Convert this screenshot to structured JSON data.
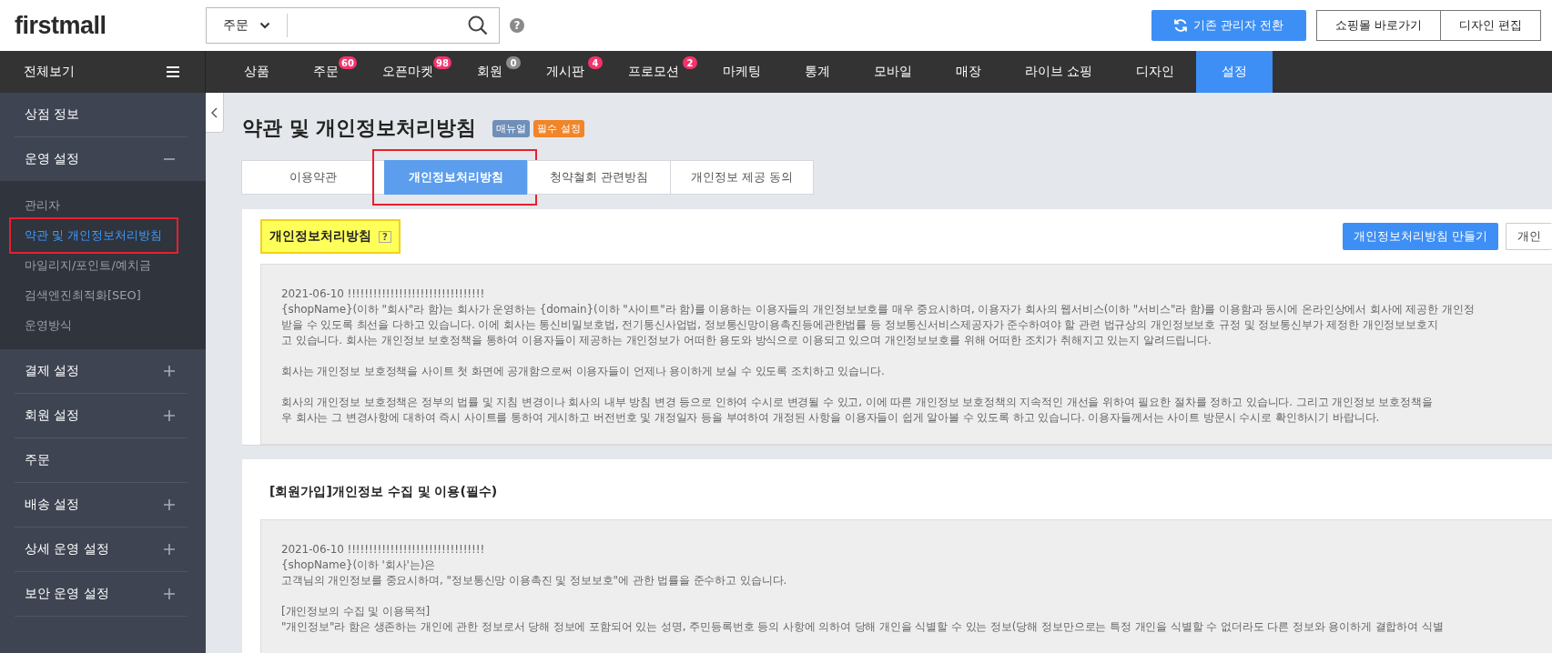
{
  "header": {
    "logo": "firstmall",
    "search": {
      "scope": "주문"
    },
    "help": "?",
    "buttons": [
      {
        "label": "기존 관리자 전환",
        "kind": "primary"
      },
      {
        "label": "쇼핑몰 바로가기",
        "kind": "default"
      },
      {
        "label": "디자인 편집",
        "kind": "default"
      }
    ]
  },
  "menu_header": {
    "label": "전체보기"
  },
  "nav": [
    {
      "label": "상품",
      "selected": false
    },
    {
      "label": "주문",
      "selected": false,
      "badge": {
        "text": "60",
        "color": "#f5336b"
      }
    },
    {
      "label": "오픈마켓",
      "selected": false,
      "badge": {
        "text": "98",
        "color": "#f5336b"
      }
    },
    {
      "label": "회원",
      "selected": false,
      "badge": {
        "text": "0",
        "color": "#8c8c8c"
      }
    },
    {
      "label": "게시판",
      "selected": false,
      "badge": {
        "text": "4",
        "color": "#f5336b"
      }
    },
    {
      "label": "프로모션",
      "selected": false,
      "badge": {
        "text": "2",
        "color": "#f5336b"
      }
    },
    {
      "label": "마케팅",
      "selected": false
    },
    {
      "label": "통계",
      "selected": false
    },
    {
      "label": "모바일",
      "selected": false
    },
    {
      "label": "매장",
      "selected": false
    },
    {
      "label": "라이브 쇼핑",
      "selected": false
    },
    {
      "label": "디자인",
      "selected": false
    },
    {
      "label": "설정",
      "selected": true
    }
  ],
  "sidebar": {
    "items": [
      {
        "label": "상점 정보"
      },
      {
        "label": "운영 설정",
        "expanded": true,
        "children": [
          {
            "label": "관리자",
            "selected": false,
            "highlighted": false
          },
          {
            "label": "약관 및 개인정보처리방침",
            "selected": true,
            "highlighted": true
          },
          {
            "label": "마일리지/포인트/예치금",
            "selected": false,
            "highlighted": false
          },
          {
            "label": "검색엔진최적화[SEO]",
            "selected": false,
            "highlighted": false
          },
          {
            "label": "운영방식",
            "selected": false,
            "highlighted": false
          }
        ]
      },
      {
        "label": "결제 설정",
        "expanded": false
      },
      {
        "label": "회원 설정",
        "expanded": false
      },
      {
        "label": "주문"
      },
      {
        "label": "배송 설정",
        "expanded": false
      },
      {
        "label": "상세 운영 설정",
        "expanded": false
      },
      {
        "label": "보안 운영 설정",
        "expanded": false
      }
    ]
  },
  "page": {
    "title": "약관 및 개인정보처리방침",
    "badges": [
      {
        "text": "매뉴얼",
        "color": "#6f8fb8"
      },
      {
        "text": "필수 설정",
        "color": "#f0852a"
      }
    ]
  },
  "tabs": [
    {
      "label": "이용약관",
      "selected": false,
      "highlighted": false
    },
    {
      "label": "개인정보처리방침",
      "selected": true,
      "highlighted": true
    },
    {
      "label": "청약철회 관련방침",
      "selected": false,
      "highlighted": false
    },
    {
      "label": "개인정보 제공 동의",
      "selected": false,
      "highlighted": false
    }
  ],
  "sections": [
    {
      "title": "개인정보처리방침",
      "help": "?",
      "highlighted": true,
      "buttons": [
        {
          "label": "개인정보처리방침 만들기",
          "kind": "primary"
        },
        {
          "label": "개인",
          "kind": "default"
        }
      ],
      "paragraphs": [
        [
          "2021-06-10 !!!!!!!!!!!!!!!!!!!!!!!!!!!!!!!!",
          "{shopName}(이하 \"회사\"라 함)는 회사가 운영하는 {domain}(이하 \"사이트\"라 함)를 이용하는 이용자들의 개인정보보호를 매우 중요시하며, 이용자가 회사의 웹서비스(이하 \"서비스\"라 함)를 이용함과 동시에 온라인상에서 회사에 제공한 개인정",
          "받을 수 있도록 최선을 다하고 있습니다. 이에 회사는 통신비밀보호법, 전기통신사업법, 정보통신망이용촉진등에관한법률 등 정보통신서비스제공자가 준수하여야 할 관련 법규상의 개인정보보호 규정 및 정보통신부가 제정한 개인정보보호지",
          "고 있습니다. 회사는 개인정보 보호정책을 통하여 이용자들이 제공하는 개인정보가 어떠한 용도와 방식으로 이용되고 있으며 개인정보보호를 위해 어떠한 조치가 취해지고 있는지 알려드립니다."
        ],
        [
          "회사는 개인정보 보호정책을 사이트 첫 화면에 공개함으로써 이용자들이 언제나 용이하게 보실 수 있도록 조치하고 있습니다."
        ],
        [
          "회사의 개인정보 보호정책은 정부의 법률 및 지침 변경이나 회사의 내부 방침 변경 등으로 인하여 수시로 변경될 수 있고, 이에 따른 개인정보 보호정책의 지속적인 개선을 위하여 필요한 절차를 정하고 있습니다. 그리고 개인정보 보호정책을",
          "우 회사는 그 변경사항에 대하여 즉시 사이트를 통하여 게시하고 버전번호 및 개정일자 등을 부여하여 개정된 사항을 이용자들이 쉽게 알아볼 수 있도록 하고 있습니다. 이용자들께서는 사이트 방문시 수시로 확인하시기 바랍니다."
        ]
      ]
    },
    {
      "title": "[회원가입]개인정보 수집 및 이용(필수)",
      "highlighted": false,
      "paragraphs": [
        [
          "2021-06-10 !!!!!!!!!!!!!!!!!!!!!!!!!!!!!!!!",
          "{shopName}(이하 '회사'는)은",
          "고객님의 개인정보를 중요시하며, \"정보통신망 이용촉진 및 정보보호\"에 관한 법률을 준수하고 있습니다."
        ],
        [
          "[개인정보의 수집 및 이용목적]",
          "\"개인정보\"라 함은 생존하는 개인에 관한 정보로서 당해 정보에 포함되어 있는 성명, 주민등록번호 등의 사항에 의하여 당해 개인을 식별할 수 있는 정보(당해 정보만으로는 특정 개인을 식별할 수 없더라도 다른 정보와 용이하게 결합하여 식별"
        ]
      ]
    }
  ]
}
